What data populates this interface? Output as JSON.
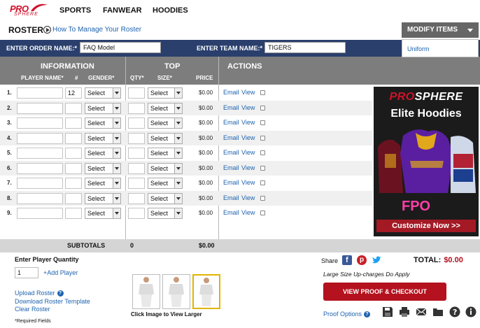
{
  "nav": {
    "logo_top": "PRO",
    "logo_bottom": "SPHERE",
    "items": [
      "SPORTS",
      "FANWEAR",
      "HOODIES"
    ]
  },
  "header": {
    "title": "ROSTER",
    "howto": "How To Manage Your Roster",
    "modify": "MODIFY ITEMS",
    "menu_item": "Uniform"
  },
  "order": {
    "order_label": "ENTER ORDER NAME:*",
    "order_value": "FAQ Model",
    "team_label": "ENTER TEAM NAME:*",
    "team_value": "TIGERS"
  },
  "table": {
    "info": "INFORMATION",
    "top": "TOP",
    "actions": "ACTIONS",
    "cols": {
      "player": "PLAYER NAME*",
      "num": "#",
      "gender": "GENDER*",
      "qty": "QTY*",
      "size": "SIZE*",
      "price": "PRICE"
    },
    "rows": [
      {
        "n": "1.",
        "num": "12",
        "gender": "Select",
        "size": "Select",
        "price": "$0.00"
      },
      {
        "n": "2.",
        "num": "",
        "gender": "Select",
        "size": "Select",
        "price": "$0.00"
      },
      {
        "n": "3.",
        "num": "",
        "gender": "Select",
        "size": "Select",
        "price": "$0.00"
      },
      {
        "n": "4.",
        "num": "",
        "gender": "Select",
        "size": "Select",
        "price": "$0.00"
      },
      {
        "n": "5.",
        "num": "",
        "gender": "Select",
        "size": "Select",
        "price": "$0.00"
      },
      {
        "n": "6.",
        "num": "",
        "gender": "Select",
        "size": "Select",
        "price": "$0.00"
      },
      {
        "n": "7.",
        "num": "",
        "gender": "Select",
        "size": "Select",
        "price": "$0.00"
      },
      {
        "n": "8.",
        "num": "",
        "gender": "Select",
        "size": "Select",
        "price": "$0.00"
      },
      {
        "n": "9.",
        "num": "",
        "gender": "Select",
        "size": "Select",
        "price": "$0.00"
      }
    ],
    "email": "Email",
    "view": "View"
  },
  "ad": {
    "brand_a": "PRO",
    "brand_b": "SPHERE",
    "title": "Elite Hoodies",
    "fpo": "FPO",
    "cta": "Customize Now >>"
  },
  "subtotals": {
    "label": "SUBTOTALS",
    "qty": "0",
    "price": "$0.00"
  },
  "bottom": {
    "enter_qty": "Enter Player Quantity",
    "qty_value": "1",
    "add_player": "+Add Player",
    "upload": "Upload Roster",
    "download": "Download Roster Template",
    "clear": "Clear Roster",
    "required": "*Required Fields",
    "thumb_caption": "Click Image to View Larger",
    "share": "Share",
    "total_label": "TOTAL:",
    "total_value": "$0.00",
    "upcharge": "Large Size Up-charges Do Apply",
    "proof_btn": "VIEW PROOF & CHECKOUT",
    "proof_options": "Proof Options"
  },
  "colors": {
    "navy": "#2a3f6c",
    "red": "#b4121e",
    "link": "#1e63b0"
  }
}
